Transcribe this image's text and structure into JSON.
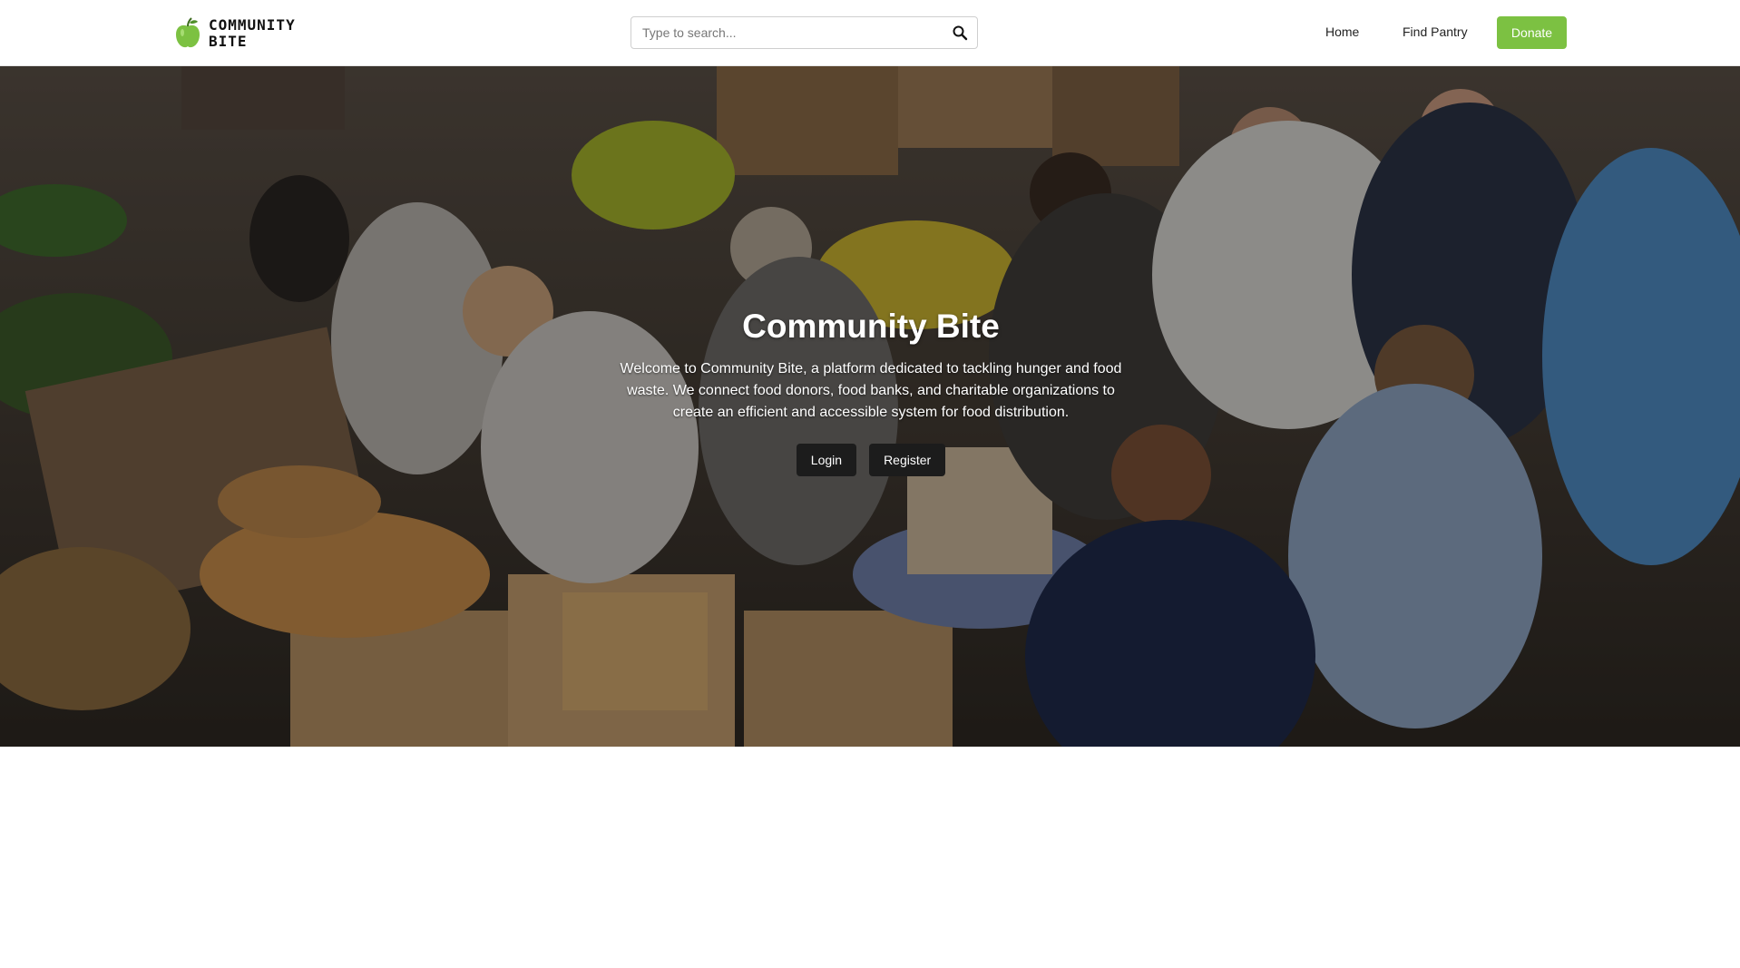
{
  "brand": {
    "name_line1": "COMMUNITY",
    "name_line2": "BITE",
    "accent": "#7cc142",
    "icon": "apple-icon"
  },
  "search": {
    "placeholder": "Type to search...",
    "icon": "search-icon"
  },
  "nav": {
    "home": "Home",
    "find_pantry": "Find Pantry",
    "donate": "Donate"
  },
  "hero": {
    "title": "Community Bite",
    "description": "Welcome to Community Bite, a platform dedicated to tackling hunger and food waste. We connect food donors, food banks, and charitable organizations to create an efficient and accessible system for food distribution.",
    "login": "Login",
    "register": "Register"
  }
}
